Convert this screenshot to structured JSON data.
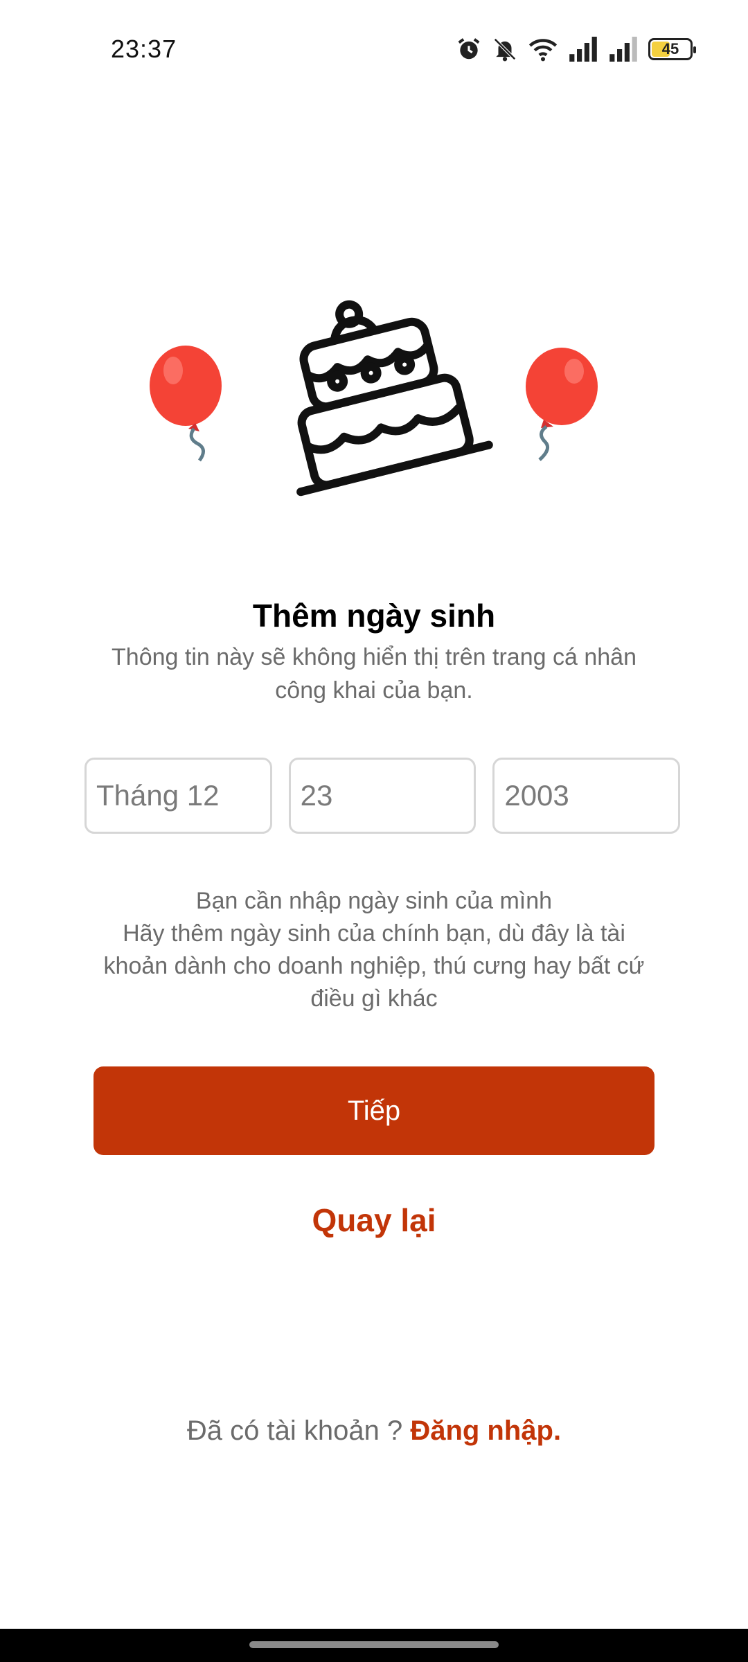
{
  "status_bar": {
    "time": "23:37",
    "battery": "45",
    "icons": [
      "alarm-icon",
      "bell-off-icon",
      "wifi-icon",
      "signal-icon",
      "signal-icon",
      "battery-icon"
    ]
  },
  "page": {
    "title": "Thêm ngày sinh",
    "subtitle": "Thông tin này sẽ không hiển thị trên trang cá nhân công khai của bạn.",
    "date": {
      "month": "Tháng 12",
      "day": "23",
      "year": "2003"
    },
    "helper_line1": "Bạn cần nhập ngày sinh của mình",
    "helper_line2": "Hãy thêm ngày sinh của chính bạn, dù đây là tài khoản dành cho doanh nghiệp, thú cưng hay bất cứ điều gì khác",
    "next_label": "Tiếp",
    "back_label": "Quay lại",
    "login_prompt": "Đã có tài khoản ? ",
    "login_link": "Đăng nhập."
  },
  "colors": {
    "accent": "#c23508",
    "balloon": "#f44336"
  }
}
